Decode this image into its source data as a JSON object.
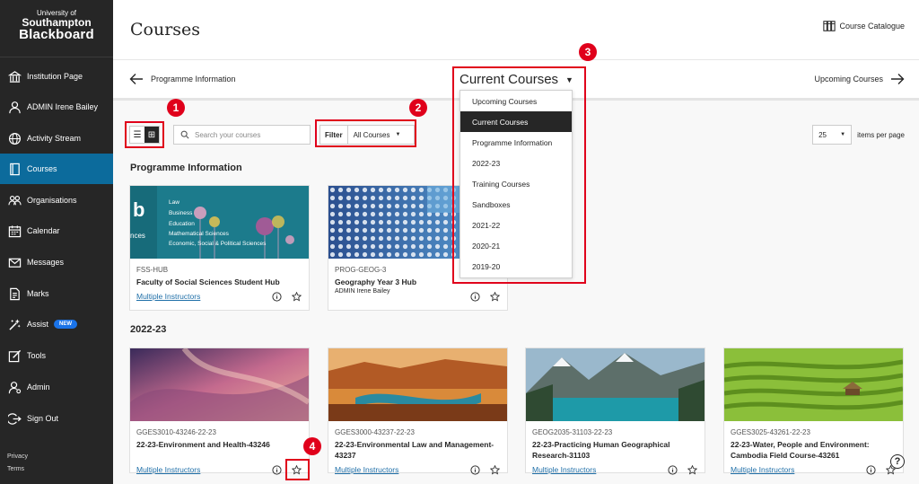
{
  "brand": {
    "line1": "University of",
    "line2": "Southampton",
    "line3": "Blackboard"
  },
  "sidebar": {
    "items": [
      {
        "label": "Institution Page",
        "icon": "institution-icon"
      },
      {
        "label": "ADMIN Irene Bailey",
        "icon": "user-icon"
      },
      {
        "label": "Activity Stream",
        "icon": "globe-icon"
      },
      {
        "label": "Courses",
        "icon": "book-icon",
        "active": true
      },
      {
        "label": "Organisations",
        "icon": "people-icon"
      },
      {
        "label": "Calendar",
        "icon": "calendar-icon"
      },
      {
        "label": "Messages",
        "icon": "envelope-icon"
      },
      {
        "label": "Marks",
        "icon": "marks-icon"
      },
      {
        "label": "Assist",
        "icon": "assist-icon",
        "badge": "NEW"
      },
      {
        "label": "Tools",
        "icon": "tools-icon"
      },
      {
        "label": "Admin",
        "icon": "admin-icon"
      },
      {
        "label": "Sign Out",
        "icon": "signout-icon"
      }
    ],
    "footer": {
      "privacy": "Privacy",
      "terms": "Terms"
    }
  },
  "header": {
    "title": "Courses",
    "catalogue": "Course Catalogue"
  },
  "subnav": {
    "prev": "Programme Information",
    "current": "Current Courses",
    "next": "Upcoming Courses"
  },
  "toolbar": {
    "search_placeholder": "Search your courses",
    "filter_label": "Filter",
    "filter_value": "All Courses",
    "per_page_value": "25",
    "per_page_label": "items per page"
  },
  "term_menu": {
    "options": [
      "Upcoming Courses",
      "Current Courses",
      "Programme Information",
      "2022-23",
      "Training Courses",
      "Sandboxes",
      "2021-22",
      "2020-21",
      "2019-20"
    ],
    "selected": "Current Courses"
  },
  "sections": [
    {
      "title": "Programme Information",
      "courses": [
        {
          "code": "FSS-HUB",
          "name": "Faculty of Social Sciences Student Hub",
          "instructor": "Multiple Instructors",
          "instructor_link": true,
          "image_text": [
            "Law",
            "Business",
            "Education",
            "Mathematical Sciences",
            "Economic, Social & Political Sciences"
          ],
          "image_big": "b",
          "image_small": "nces"
        },
        {
          "code": "PROG-GEOG-3",
          "name": "Geography Year 3 Hub",
          "instructor": "ADMIN Irene Bailey",
          "instructor_link": false
        }
      ]
    },
    {
      "title": "2022-23",
      "courses": [
        {
          "code": "GGES3010-43246-22-23",
          "name": "22-23-Environment and Health-43246",
          "instructor": "Multiple Instructors"
        },
        {
          "code": "GGES3000-43237-22-23",
          "name": "22-23-Environmental Law and Management-43237",
          "instructor": "Multiple Instructors"
        },
        {
          "code": "GEOG2035-31103-22-23",
          "name": "22-23-Practicing Human Geographical Research-31103",
          "instructor": "Multiple Instructors"
        },
        {
          "code": "GGES3025-43261-22-23",
          "name": "22-23-Water, People and Environment: Cambodia Field Course-43261",
          "instructor": "Multiple Instructors"
        }
      ]
    }
  ],
  "annotations": [
    "1",
    "2",
    "3",
    "4"
  ],
  "colors": {
    "sidebar": "#262626",
    "active": "#0c6b9c",
    "annotation": "#e0001b",
    "link": "#1f6fa8"
  }
}
